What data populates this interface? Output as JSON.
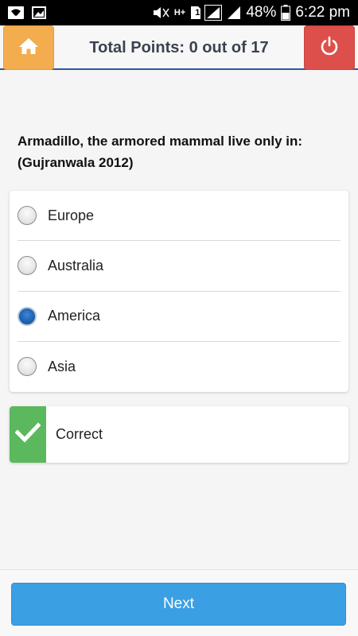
{
  "status_bar": {
    "battery": "48%",
    "time": "6:22 pm",
    "network_h": "H+",
    "sim": "1"
  },
  "header": {
    "title": "Total Points: 0 out of 17"
  },
  "question": {
    "text": "Armadillo, the armored mammal live only in: (Gujranwala 2012)"
  },
  "options": [
    {
      "label": "Europe",
      "selected": false
    },
    {
      "label": "Australia",
      "selected": false
    },
    {
      "label": "America",
      "selected": true
    },
    {
      "label": "Asia",
      "selected": false
    }
  ],
  "result": {
    "label": "Correct"
  },
  "footer": {
    "next_label": "Next"
  },
  "colors": {
    "home": "#f3ad4e",
    "power": "#dd4f4a",
    "correct": "#5cb85c",
    "next": "#3b9fe3"
  }
}
